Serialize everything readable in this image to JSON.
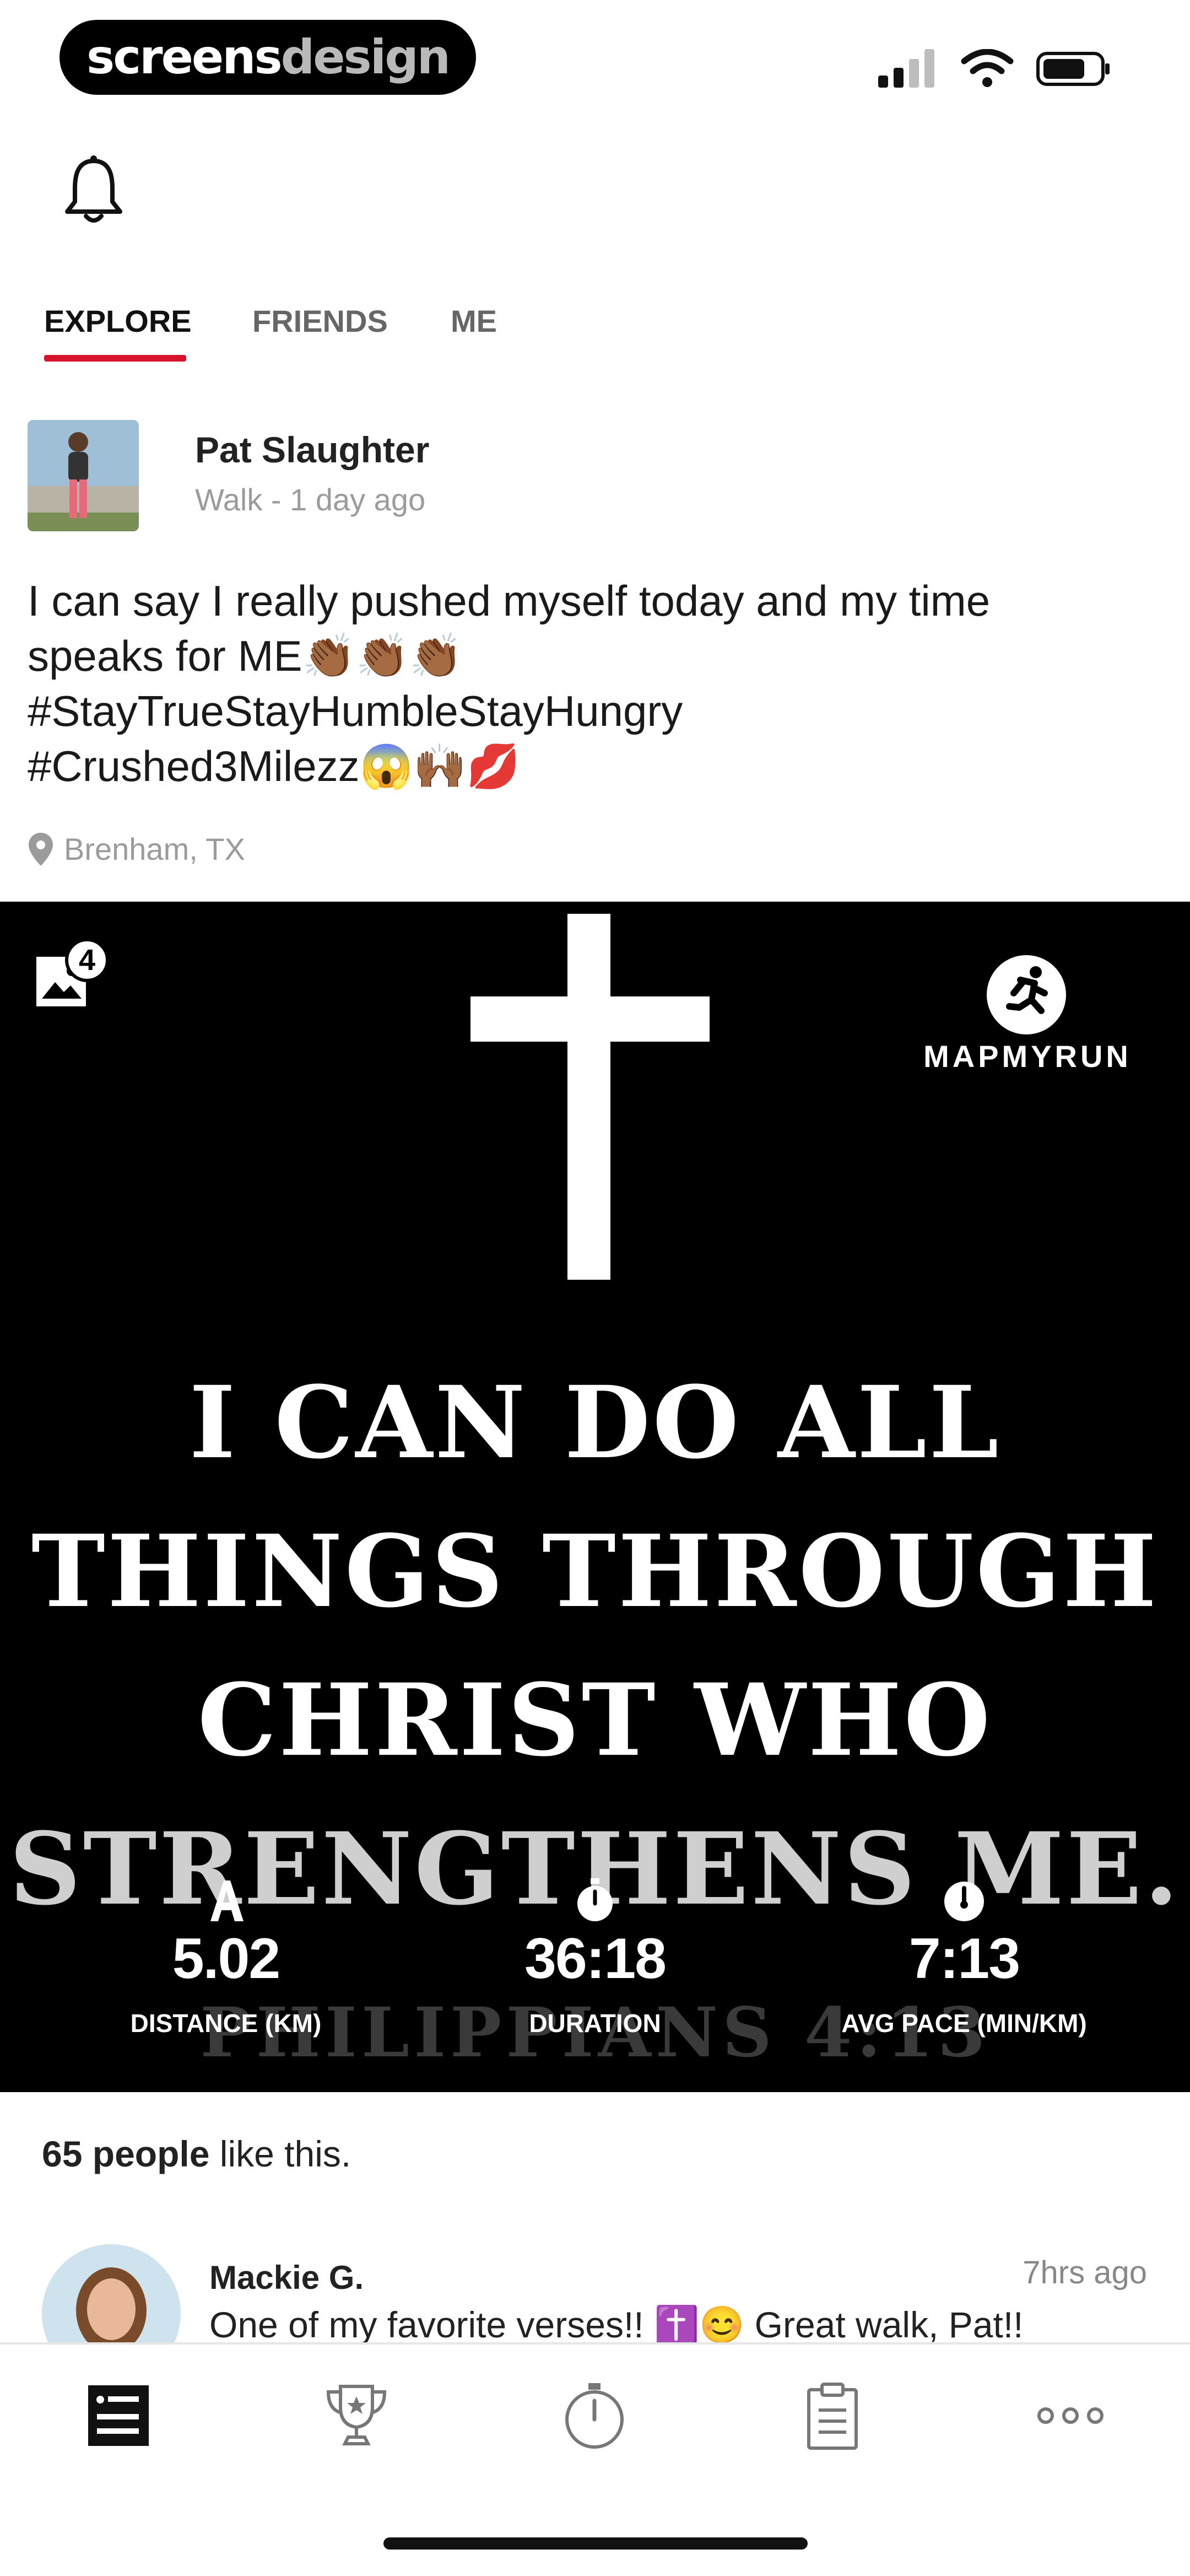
{
  "status_bar": {
    "brand_left": "screens",
    "brand_right": "design",
    "icons": [
      "signal-icon",
      "wifi-icon",
      "battery-icon"
    ]
  },
  "header": {
    "icon": "bell-icon"
  },
  "tabs": [
    {
      "label": "EXPLORE",
      "active": true
    },
    {
      "label": "FRIENDS",
      "active": false
    },
    {
      "label": "ME",
      "active": false
    }
  ],
  "post": {
    "user_name": "Pat Slaughter",
    "meta": "Walk - 1 day ago",
    "body": "I can say I really pushed myself today and my time\nspeaks for ME👏🏾👏🏾👏🏾\n#StayTrueStayHumbleStayHungry\n#Crushed3Milezz😱🙌🏾💋",
    "location": "Brenham, TX",
    "media": {
      "photo_count": "4",
      "brand_logo_text": "MAPMYRUN",
      "verse_lines": [
        "I CAN DO ALL",
        "THINGS THROUGH",
        "CHRIST WHO",
        "STRENGTHENS ME."
      ],
      "reference": "PHILIPPIANS 4:13",
      "stats": [
        {
          "icon": "distance-icon",
          "value": "5.02",
          "label": "DISTANCE (KM)"
        },
        {
          "icon": "stopwatch-icon",
          "value": "36:18",
          "label": "DURATION"
        },
        {
          "icon": "pace-gauge-icon",
          "value": "7:13",
          "label": "AVG PACE (MIN/KM)"
        }
      ]
    },
    "likes": {
      "count": "65 people",
      "suffix": " like this."
    },
    "comment": {
      "name": "Mackie G.",
      "time": "7hrs ago",
      "text": "One of my favorite verses!! ✝️😊 Great walk, Pat!!"
    }
  },
  "bottom_nav": [
    {
      "icon": "feed-icon",
      "active": true
    },
    {
      "icon": "trophy-icon",
      "active": false
    },
    {
      "icon": "stopwatch-icon",
      "active": false
    },
    {
      "icon": "clipboard-icon",
      "active": false
    },
    {
      "icon": "more-icon",
      "active": false
    }
  ]
}
